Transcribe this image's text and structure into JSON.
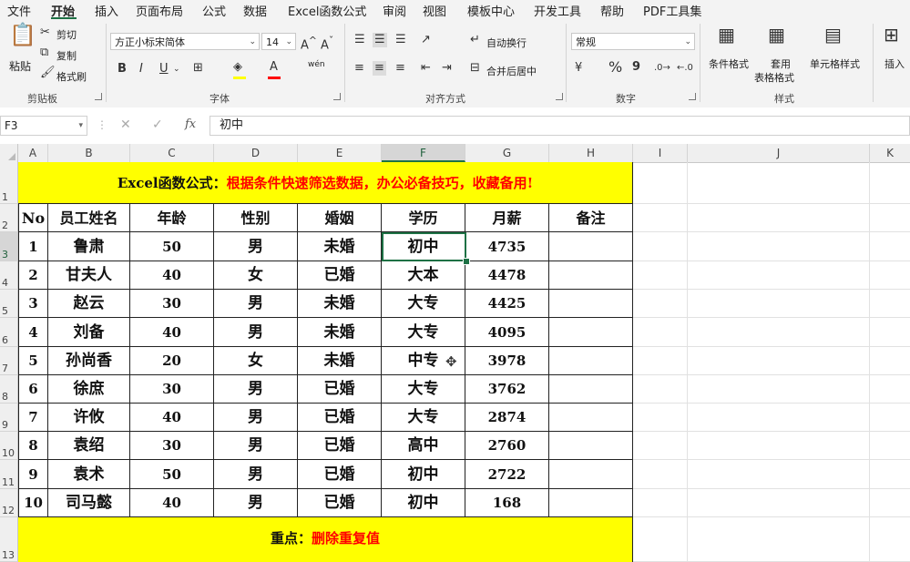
{
  "menu": [
    "文件",
    "开始",
    "插入",
    "页面布局",
    "公式",
    "数据",
    "Excel函数公式",
    "审阅",
    "视图",
    "模板中心",
    "开发工具",
    "帮助",
    "PDF工具集"
  ],
  "menu_active_index": 1,
  "ribbon": {
    "clipboard": {
      "paste": "粘贴",
      "cut": "剪切",
      "copy": "复制",
      "format_painter": "格式刷",
      "label": "剪贴板"
    },
    "font": {
      "name": "方正小标宋简体",
      "size": "14",
      "bold": "B",
      "italic": "I",
      "underline": "U",
      "phonetic": "wén",
      "label": "字体"
    },
    "alignment": {
      "wrap": "自动换行",
      "merge": "合并后居中",
      "label": "对齐方式"
    },
    "number": {
      "format": "常规",
      "percent": "%",
      "comma": "9",
      "label": "数字"
    },
    "styles": {
      "conditional": "条件格式",
      "table_format_1": "套用",
      "table_format_2": "表格格式",
      "cell_styles": "单元格样式",
      "label": "样式"
    },
    "cells": {
      "insert": "插入"
    }
  },
  "formula_bar": {
    "name_box": "F3",
    "fx": "fx",
    "content": "初中"
  },
  "columns": [
    "A",
    "B",
    "C",
    "D",
    "E",
    "F",
    "G",
    "H",
    "I",
    "J",
    "K"
  ],
  "selected_column": "F",
  "rows": [
    "1",
    "2",
    "3",
    "4",
    "5",
    "6",
    "7",
    "8",
    "9",
    "10",
    "11",
    "12",
    "13"
  ],
  "selected_row": "3",
  "sheet": {
    "title_black": "Excel函数公式：",
    "title_red": "根据条件快速筛选数据，办公必备技巧，收藏备用!",
    "headers": [
      "No",
      "员工姓名",
      "年龄",
      "性别",
      "婚姻",
      "学历",
      "月薪",
      "备注"
    ],
    "data": [
      [
        "1",
        "鲁肃",
        "50",
        "男",
        "未婚",
        "初中",
        "4735",
        ""
      ],
      [
        "2",
        "甘夫人",
        "40",
        "女",
        "已婚",
        "大本",
        "4478",
        ""
      ],
      [
        "3",
        "赵云",
        "30",
        "男",
        "未婚",
        "大专",
        "4425",
        ""
      ],
      [
        "4",
        "刘备",
        "40",
        "男",
        "未婚",
        "大专",
        "4095",
        ""
      ],
      [
        "5",
        "孙尚香",
        "20",
        "女",
        "未婚",
        "中专",
        "3978",
        ""
      ],
      [
        "6",
        "徐庶",
        "30",
        "男",
        "已婚",
        "大专",
        "3762",
        ""
      ],
      [
        "7",
        "许攸",
        "40",
        "男",
        "已婚",
        "大专",
        "2874",
        ""
      ],
      [
        "8",
        "袁绍",
        "30",
        "男",
        "已婚",
        "高中",
        "2760",
        ""
      ],
      [
        "9",
        "袁术",
        "50",
        "男",
        "已婚",
        "初中",
        "2722",
        ""
      ],
      [
        "10",
        "司马懿",
        "40",
        "男",
        "已婚",
        "初中",
        "168",
        ""
      ]
    ],
    "footer_black": "重点：",
    "footer_red": "删除重复值"
  },
  "colors": {
    "accent": "#1e7145",
    "highlight": "#ffff00",
    "red": "#ff0000"
  }
}
